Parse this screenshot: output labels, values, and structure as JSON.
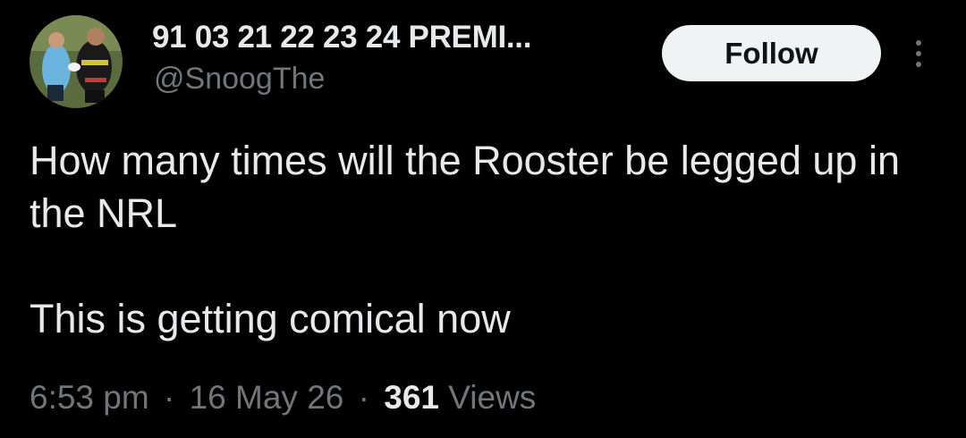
{
  "author": {
    "display_name": "91 03 21 22 23 24 PREMI...",
    "handle": "@SnoogThe",
    "avatar_icon": "profile-photo-rugby-players"
  },
  "actions": {
    "follow_label": "Follow",
    "more_icon": "more-vertical-icon"
  },
  "tweet": {
    "text_line1": "How many times will the Rooster be legged up in the NRL",
    "text_line2": "This is getting comical now"
  },
  "meta": {
    "time": "6:53 pm",
    "separator": "·",
    "date": "16 May 26",
    "views_count": "361",
    "views_label": "Views"
  },
  "colors": {
    "background": "#000000",
    "primary_text": "#e7e9ea",
    "secondary_text": "#71767b",
    "follow_bg": "#eff3f4",
    "follow_text": "#0f1419"
  }
}
